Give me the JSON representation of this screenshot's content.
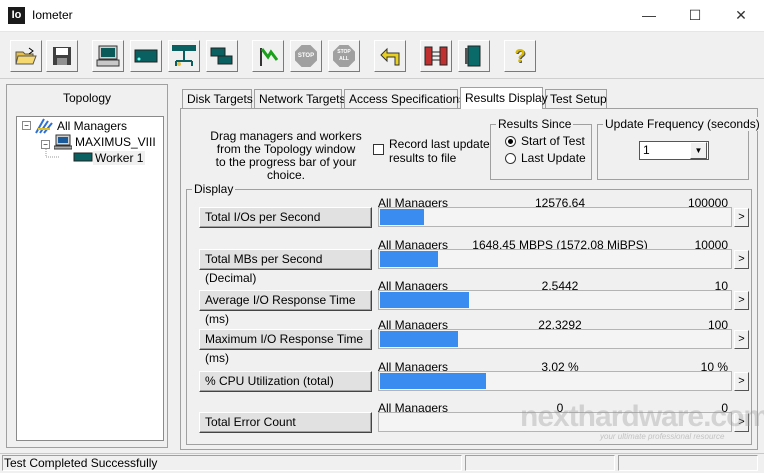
{
  "window": {
    "app_icon_text": "Io",
    "title": "Iometer",
    "minimize": "—",
    "maximize": "☐",
    "close": "✕"
  },
  "toolbar": {
    "buttons": [
      {
        "icon": "open-folder-icon"
      },
      {
        "icon": "save-disk-icon"
      },
      {
        "icon": "new-disk-worker-icon"
      },
      {
        "icon": "new-network-worker-icon"
      },
      {
        "icon": "new-manager-icon"
      },
      {
        "icon": "duplicate-worker-icon"
      },
      {
        "icon": "start-flag-icon"
      },
      {
        "icon": "stop-icon",
        "label": "STOP"
      },
      {
        "icon": "stop-all-icon",
        "label": "STOP ALL"
      },
      {
        "icon": "reset-workers-icon"
      },
      {
        "icon": "exit-icon"
      },
      {
        "icon": "help-icon",
        "label": "?"
      }
    ]
  },
  "topology": {
    "title": "Topology",
    "tree": [
      {
        "label": "All Managers",
        "icon": "all-managers-icon",
        "level": 0
      },
      {
        "label": "MAXIMUS_VIII",
        "icon": "computer-icon",
        "level": 1
      },
      {
        "label": "Worker 1",
        "icon": "worker-icon",
        "level": 2
      }
    ]
  },
  "tabs": [
    {
      "label": "Disk Targets",
      "active": false
    },
    {
      "label": "Network Targets",
      "active": false
    },
    {
      "label": "Access Specifications",
      "active": false
    },
    {
      "label": "Results Display",
      "active": true
    },
    {
      "label": "Test Setup",
      "active": false
    }
  ],
  "results": {
    "drag_hint": [
      "Drag managers and workers",
      "from the Topology window",
      "to the progress bar of your choice."
    ],
    "record_checkbox": {
      "label_line1": "Record last update",
      "label_line2": "results to file",
      "checked": false
    },
    "results_since": {
      "title": "Results Since",
      "options": [
        {
          "label": "Start of Test",
          "selected": true
        },
        {
          "label": "Last Update",
          "selected": false
        }
      ]
    },
    "update_frequency": {
      "title": "Update Frequency (seconds)",
      "value": "1",
      "arrow": "▼"
    },
    "display_title": "Display",
    "arrow_symbol": ">",
    "rows": [
      {
        "metric": "Total I/Os per Second",
        "source": "All Managers",
        "value": "12576.64",
        "max": "100000",
        "fraction": 0.126
      },
      {
        "metric": "Total MBs per Second (Decimal)",
        "source": "All Managers",
        "value": "1648.45 MBPS (1572.08 MiBPS)",
        "max": "10000",
        "fraction": 0.165
      },
      {
        "metric": "Average I/O Response Time (ms)",
        "source": "All Managers",
        "value": "2.5442",
        "max": "10",
        "fraction": 0.254
      },
      {
        "metric": "Maximum I/O Response Time (ms)",
        "source": "All Managers",
        "value": "22.3292",
        "max": "100",
        "fraction": 0.223
      },
      {
        "metric": "% CPU Utilization (total)",
        "source": "All Managers",
        "value": "3.02 %",
        "max": "10 %",
        "fraction": 0.302
      },
      {
        "metric": "Total Error Count",
        "source": "All Managers",
        "value": "0",
        "max": "0",
        "fraction": 0
      }
    ]
  },
  "watermark": {
    "brand": "nexthardware.com",
    "tagline": "your ultimate professional resource"
  },
  "status": {
    "text": "Test Completed Successfully"
  },
  "colors": {
    "bar": "#3a8cf0"
  }
}
